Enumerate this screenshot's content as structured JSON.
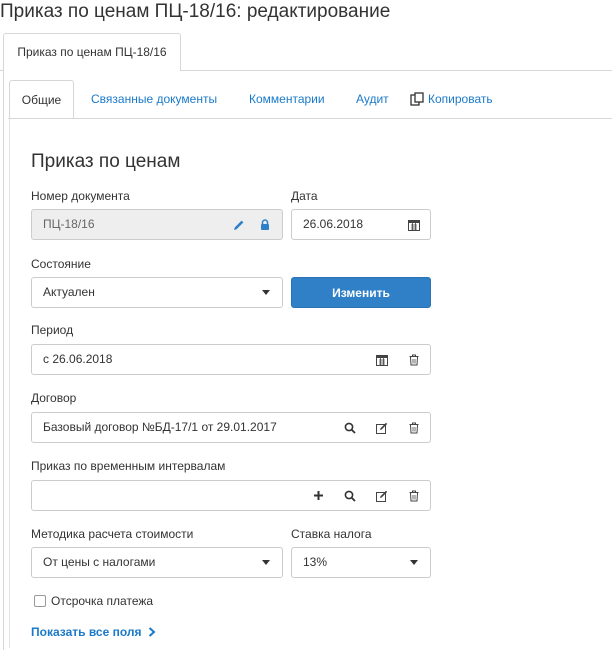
{
  "page_title": "Приказ по ценам ПЦ-18/16: редактирование",
  "outer_tab": "Приказ по ценам ПЦ-18/16",
  "inner_tabs": [
    {
      "label": "Общие"
    },
    {
      "label": "Связанные документы"
    },
    {
      "label": "Комментарии"
    },
    {
      "label": "Аудит"
    },
    {
      "label": "Копировать",
      "icon": "copy-icon"
    }
  ],
  "section_title": "Приказ по ценам",
  "doc_number": {
    "label": "Номер документа",
    "value": "ПЦ-18/16",
    "icons": [
      "pencil-icon",
      "lock-icon"
    ]
  },
  "date": {
    "label": "Дата",
    "value": "26.06.2018",
    "icon": "calendar-icon"
  },
  "status": {
    "label": "Состояние",
    "value": "Актуален",
    "button": "Изменить"
  },
  "period": {
    "label": "Период",
    "value": "с 26.06.2018",
    "icons": [
      "calendar-icon",
      "trash-icon"
    ]
  },
  "contract": {
    "label": "Договор",
    "value": "Базовый договор №БД-17/1 от 29.01.2017",
    "icons": [
      "search-icon",
      "edit-icon",
      "trash-icon"
    ]
  },
  "interval_order": {
    "label": "Приказ по временным интервалам",
    "value": "",
    "icons": [
      "plus-icon",
      "search-icon",
      "edit-icon",
      "trash-icon"
    ]
  },
  "calc_method": {
    "label": "Методика расчета стоимости",
    "value": "От цены с налогами"
  },
  "tax_rate": {
    "label": "Ставка налога",
    "value": "13%"
  },
  "deferral": {
    "label": "Отсрочка платежа",
    "checked": false
  },
  "show_all": "Показать все поля",
  "colors": {
    "accent": "#2f80c7",
    "link": "#1a7ac9",
    "border": "#cccccc"
  }
}
